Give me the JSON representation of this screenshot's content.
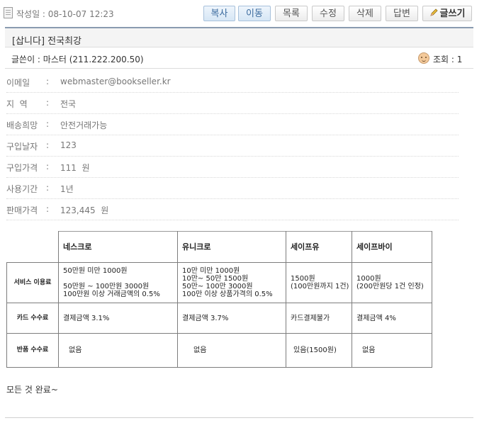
{
  "header": {
    "date": "작성일 : 08-10-07 12:23",
    "buttons": [
      "복사",
      "이동",
      "목록",
      "수정",
      "삭제",
      "답변"
    ],
    "write_label": "글쓰기"
  },
  "post": {
    "title": "[삽니다] 전국최강",
    "author": "글쓴이 : 마스터 (211.222.200.50)",
    "views": "조회 : 1"
  },
  "fields": [
    {
      "label": "이메일",
      "value": "webmaster@bookseller.kr"
    },
    {
      "label": "지  역",
      "value": "전국"
    },
    {
      "label": "배송희망",
      "value": "안전거래가능"
    },
    {
      "label": "구입날자",
      "value": "123"
    },
    {
      "label": "구입가격",
      "value": "111  원"
    },
    {
      "label": "사용기간",
      "value": "1년"
    },
    {
      "label": "판매가격",
      "value": "123,445  원"
    }
  ],
  "table": {
    "headers": [
      "네스크로",
      "유니크로",
      "세이프유",
      "세이프바이"
    ],
    "rows": [
      {
        "label": "서비스 이용료",
        "cells": [
          [
            "50만원 미만   1000원",
            "",
            "50만원 ~ 100만원 3000원",
            "100만원 이상    거래금액의 0.5%"
          ],
          [
            "10만 미만   1000원",
            "10만~  50만 1500원",
            "50만~  100만  3000원",
            "100만 이상  상품가격의 0.5%"
          ],
          [
            "1500원",
            "(100만원까지 1건)"
          ],
          [
            "1000원",
            "(200만원당 1건 인정)"
          ]
        ]
      },
      {
        "label": "카드 수수료",
        "cells": [
          [
            "결제금액 3.1%"
          ],
          [
            "결제금액 3.7%"
          ],
          [
            "카드결제불가"
          ],
          [
            "결제금액 4%"
          ]
        ]
      },
      {
        "label": "반품 수수료",
        "cells": [
          [
            "없음"
          ],
          [
            "없음"
          ],
          [
            "있음(1500원)"
          ],
          [
            "없음"
          ]
        ]
      }
    ]
  },
  "content": {
    "text": "모든 것 완료~"
  }
}
